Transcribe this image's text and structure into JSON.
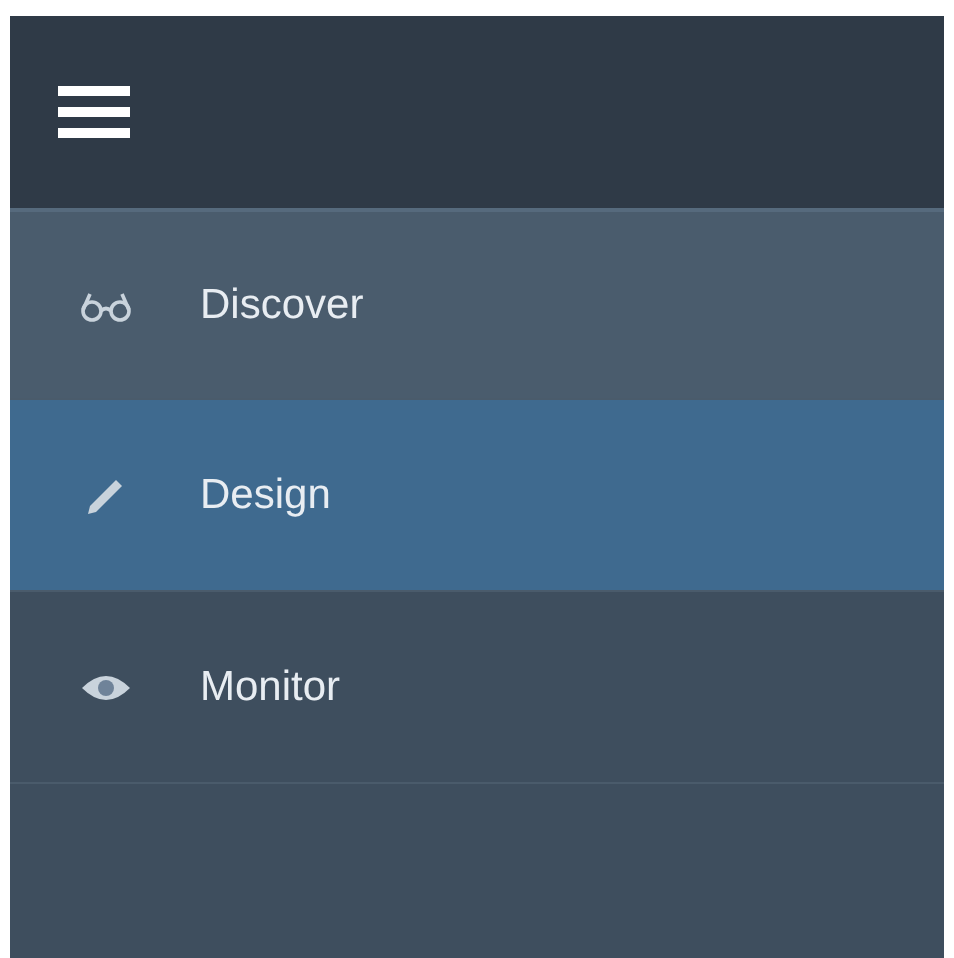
{
  "menu": {
    "items": [
      {
        "label": "Discover",
        "selected": false,
        "hovered": true
      },
      {
        "label": "Design",
        "selected": true,
        "hovered": false
      },
      {
        "label": "Monitor",
        "selected": false,
        "hovered": false
      }
    ]
  }
}
